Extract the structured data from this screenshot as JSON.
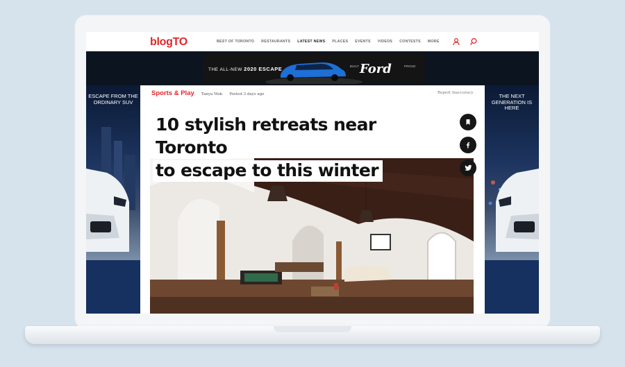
{
  "header": {
    "logo": "blogTO",
    "nav": [
      {
        "label": "BEST OF TORONTO",
        "active": false
      },
      {
        "label": "RESTAURANTS",
        "active": false
      },
      {
        "label": "LATEST NEWS",
        "active": true
      },
      {
        "label": "PLACES",
        "active": false
      },
      {
        "label": "EVENTS",
        "active": false
      },
      {
        "label": "VIDEOS",
        "active": false
      },
      {
        "label": "CONTESTS",
        "active": false
      },
      {
        "label": "MORE",
        "active": false
      }
    ],
    "icons": [
      "user-icon",
      "search-icon"
    ]
  },
  "top_ad": {
    "line_prefix": "THE ALL-NEW ",
    "line_bold": "2020 ESCAPE",
    "built": "BUILT",
    "brand": "Ford",
    "proud": "PROUD"
  },
  "left_ad": {
    "copy": "ESCAPE FROM THE ORDINARY SUV"
  },
  "right_ad": {
    "copy": "THE NEXT GENERATION IS HERE"
  },
  "article": {
    "category": "Sports & Play",
    "author": "Tanya Mok",
    "posted": "Posted 3 days ago",
    "report": "Report Inaccuracy",
    "headline_line1": "10 stylish retreats near Toronto",
    "headline_line2": "to escape to this winter"
  },
  "share": [
    "bookmark-icon",
    "facebook-icon",
    "twitter-icon"
  ],
  "colors": {
    "brand_red": "#e3262a",
    "ad_blue": "#16305f"
  }
}
